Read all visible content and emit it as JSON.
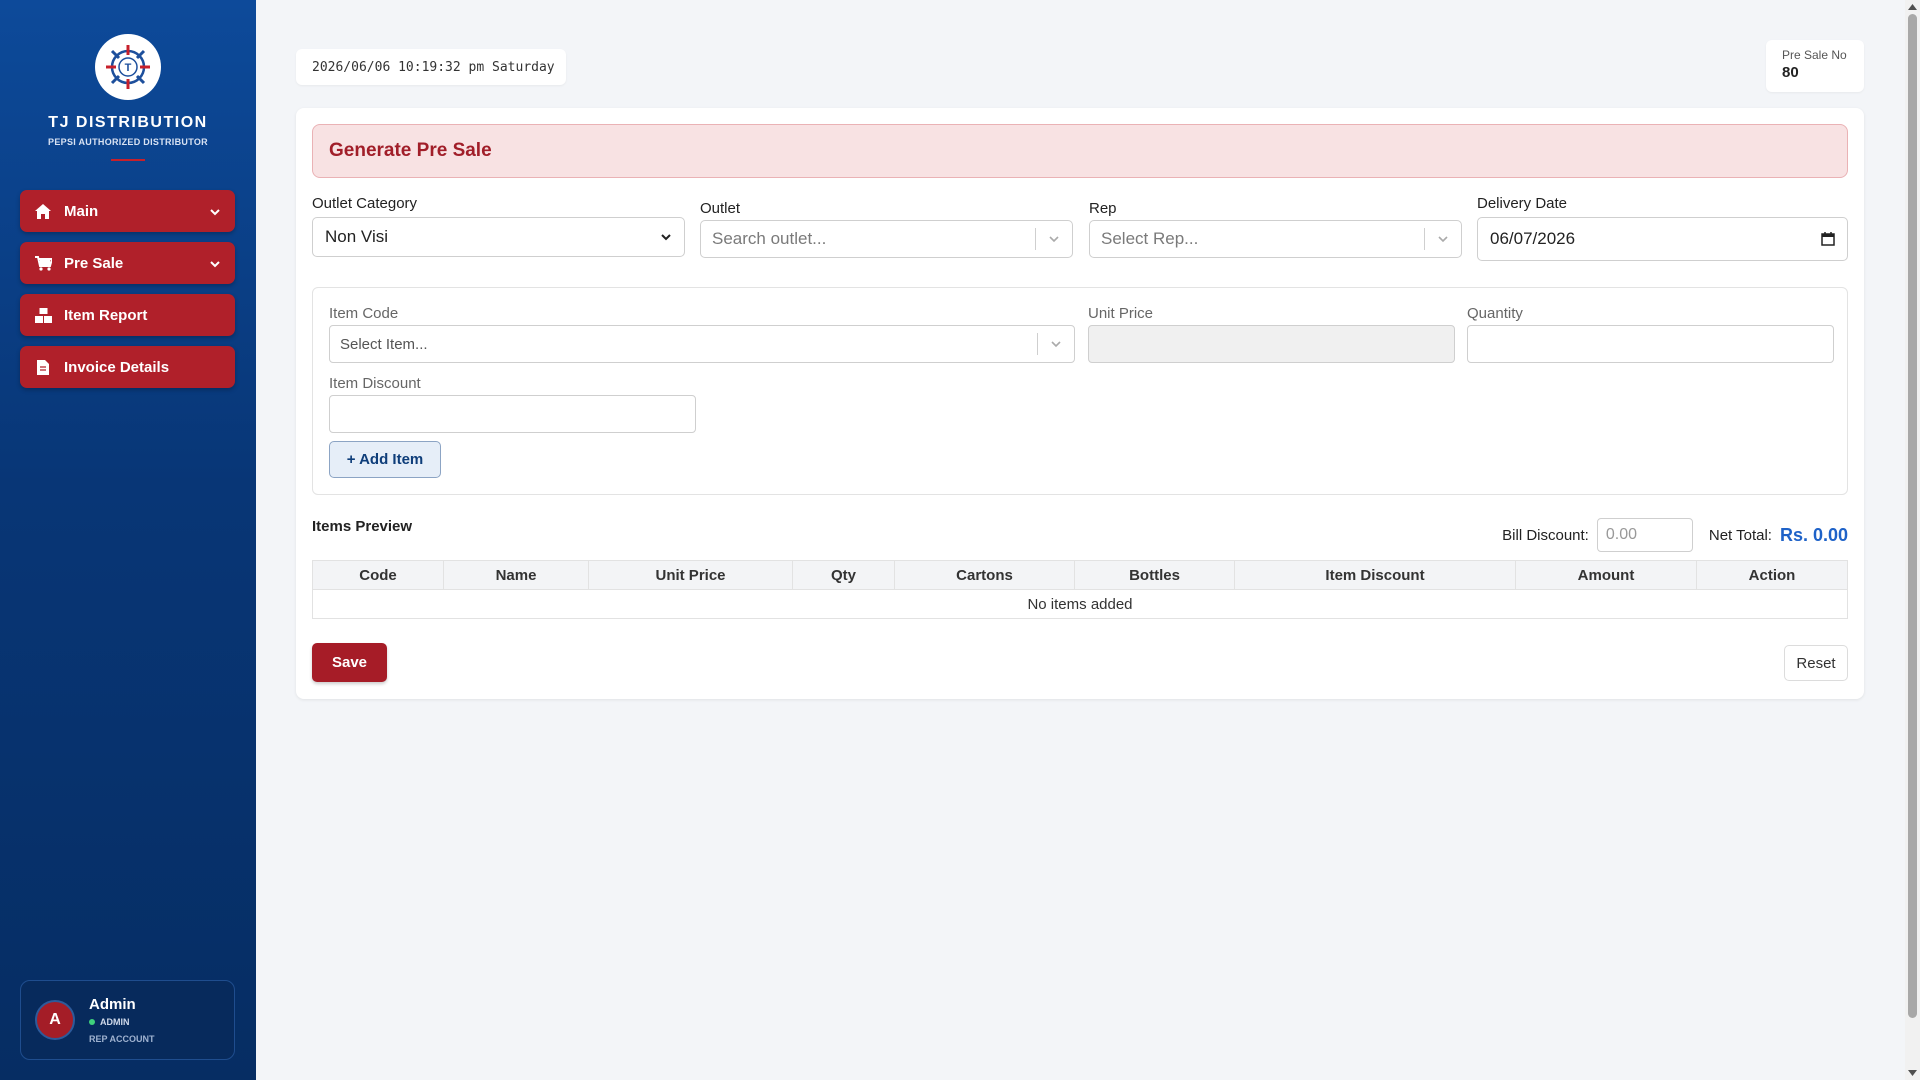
{
  "brand": {
    "name": "TJ DISTRIBUTION",
    "subtitle": "PEPSI AUTHORIZED DISTRIBUTOR",
    "logo_letter": "T"
  },
  "sidebar": {
    "items": [
      {
        "label": "Main",
        "icon": "home-icon",
        "expandable": true
      },
      {
        "label": "Pre Sale",
        "icon": "cart-icon",
        "expandable": true
      },
      {
        "label": "Item Report",
        "icon": "boxes-icon",
        "expandable": false
      },
      {
        "label": "Invoice Details",
        "icon": "document-icon",
        "expandable": false
      }
    ]
  },
  "profile": {
    "initial": "A",
    "name": "Admin",
    "role": "ADMIN",
    "account": "REP ACCOUNT"
  },
  "header": {
    "datetime": "2026/06/06 10:19:32 pm Saturday",
    "presale_label": "Pre Sale No",
    "presale_value": "80"
  },
  "form": {
    "title": "Generate Pre Sale",
    "outlet_category": {
      "label": "Outlet Category",
      "value": "Non Visi"
    },
    "outlet": {
      "label": "Outlet",
      "placeholder": "Search outlet..."
    },
    "rep": {
      "label": "Rep",
      "placeholder": "Select Rep..."
    },
    "delivery_date": {
      "label": "Delivery Date",
      "value": "06/07/2026"
    },
    "item_code": {
      "label": "Item Code",
      "placeholder": "Select Item..."
    },
    "unit_price": {
      "label": "Unit Price"
    },
    "quantity": {
      "label": "Quantity"
    },
    "item_discount": {
      "label": "Item Discount"
    },
    "add_item": "+ Add Item"
  },
  "preview": {
    "title": "Items Preview",
    "bill_discount_label": "Bill Discount:",
    "bill_discount_placeholder": "0.00",
    "net_total_label": "Net Total:",
    "net_total_value": "Rs. 0.00",
    "columns": [
      "Code",
      "Name",
      "Unit Price",
      "Qty",
      "Cartons",
      "Bottles",
      "Item Discount",
      "Amount",
      "Action"
    ],
    "empty_text": "No items added"
  },
  "actions": {
    "save": "Save",
    "reset": "Reset"
  },
  "colors": {
    "sidebar": "#0a3f85",
    "accent_red": "#a61c27",
    "net_total_blue": "#1e62c8"
  }
}
